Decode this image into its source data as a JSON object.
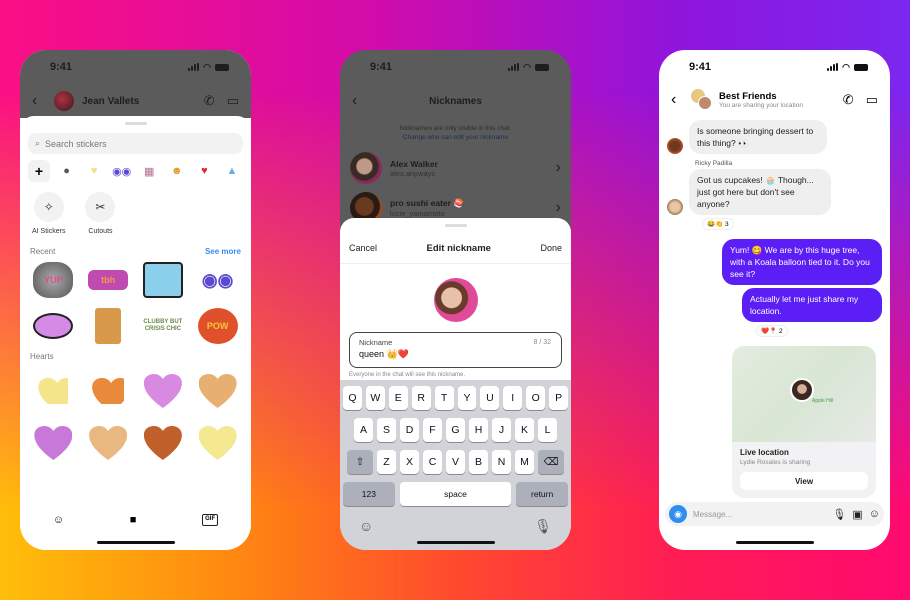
{
  "phones": {
    "stickers": {
      "time": "9:41",
      "contact_name": "Jean Vallets",
      "search_placeholder": "Search stickers",
      "tools": [
        {
          "label": "AI Stickers",
          "icon": "sparkle-icon"
        },
        {
          "label": "Cutouts",
          "icon": "scissors-icon"
        }
      ],
      "recent_label": "Recent",
      "see_more": "See more",
      "recent_stickers": [
        "YUP",
        "tbh",
        "",
        "",
        "",
        "",
        "CLUBBY BUT CRISIS CHIC",
        "POW"
      ],
      "hearts_label": "Hearts",
      "bottom_nav": [
        "avatar-icon",
        "sticker-icon",
        "gif-icon"
      ],
      "gif_label": "GIF"
    },
    "nicknames": {
      "time": "9:41",
      "title": "Nicknames",
      "note": "Nicknames are only visible in this chat.",
      "note_link": "Change who can edit your nickname",
      "people": [
        {
          "name": "Alex Walker",
          "username": "alex.anyways"
        },
        {
          "name": "pro sushi eater 🍣",
          "username": "lucie_yamamoto"
        }
      ],
      "sheet": {
        "cancel": "Cancel",
        "title": "Edit nickname",
        "done": "Done",
        "field_label": "Nickname",
        "field_value": "queen 👑❤️",
        "counter": "8 / 32",
        "hint": "Everyone in the chat will see this nickname."
      },
      "keyboard": {
        "row1": [
          "Q",
          "W",
          "E",
          "R",
          "T",
          "Y",
          "U",
          "I",
          "O",
          "P"
        ],
        "row2": [
          "A",
          "S",
          "D",
          "F",
          "G",
          "H",
          "J",
          "K",
          "L"
        ],
        "row3": [
          "Z",
          "X",
          "C",
          "V",
          "B",
          "N",
          "M"
        ],
        "numbers": "123",
        "space": "space",
        "return": "return"
      }
    },
    "chat": {
      "time": "9:41",
      "title": "Best Friends",
      "subtitle": "You are sharing your location",
      "messages": [
        {
          "text": "Is someone bringing dessert to this thing? 👀",
          "direction": "in"
        },
        {
          "sender": "Ricky Padilla",
          "text": "Got us cupcakes! 🧁 Though... just got here but don't see anyone?",
          "direction": "in",
          "reactions": "😂👏 3"
        },
        {
          "text": "Yum! 😋 We are by this huge tree, with a Koala balloon tied to it. Do you see it?",
          "direction": "out"
        },
        {
          "text": "Actually let me just share my location.",
          "direction": "out",
          "reactions": "❤️📍 2"
        }
      ],
      "location": {
        "title": "Live location",
        "subtitle": "Lydie Rosales is sharing",
        "button": "View",
        "map_label": "Apple Hill"
      },
      "composer_placeholder": "Message..."
    }
  },
  "colors": {
    "outgoing_bubble": "#5b1ff5",
    "link": "#3a8ee6",
    "camera": "#2f8ef0"
  }
}
